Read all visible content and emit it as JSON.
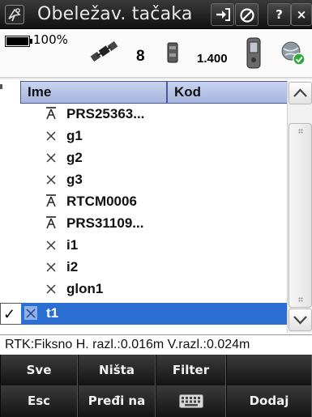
{
  "window": {
    "title": "Obeležav. tačaka",
    "help_label": "?",
    "close_label": "×"
  },
  "status": {
    "battery_text": "100%",
    "satellites": "8",
    "antenna_height": "1.400"
  },
  "table": {
    "columns": [
      "Ime",
      "Kod"
    ],
    "rows": [
      {
        "symbol": "control",
        "name": "PRS25363...",
        "selected": false
      },
      {
        "symbol": "point",
        "name": "g1",
        "selected": false
      },
      {
        "symbol": "point",
        "name": "g2",
        "selected": false
      },
      {
        "symbol": "point",
        "name": "g3",
        "selected": false
      },
      {
        "symbol": "control",
        "name": "RTCM0006",
        "selected": false
      },
      {
        "symbol": "control",
        "name": "PRS31109...",
        "selected": false
      },
      {
        "symbol": "point",
        "name": "i1",
        "selected": false
      },
      {
        "symbol": "point",
        "name": "i2",
        "selected": false
      },
      {
        "symbol": "point",
        "name": "glon1",
        "selected": false
      },
      {
        "symbol": "point",
        "name": "t1",
        "selected": true,
        "check": "✓"
      }
    ]
  },
  "status_line": "RTK:Fiksno H. razl.:0.016m V.razl.:0.024m",
  "softkeys_row1": {
    "b1": "Sve",
    "b2": "Ništa",
    "b3": "Filter",
    "b4": ""
  },
  "softkeys_row2": {
    "b1": "Esc",
    "b2": "Pređi na",
    "b3_icon": "keyboard-icon",
    "b4": "Dodaj"
  },
  "colors": {
    "selection": "#2a6fd1",
    "header_fill": "#b8c4ea",
    "titlebar": "#1a1a1a",
    "softkey_bar": "#1b1b1b",
    "ok_badge": "#2eaa3a"
  }
}
